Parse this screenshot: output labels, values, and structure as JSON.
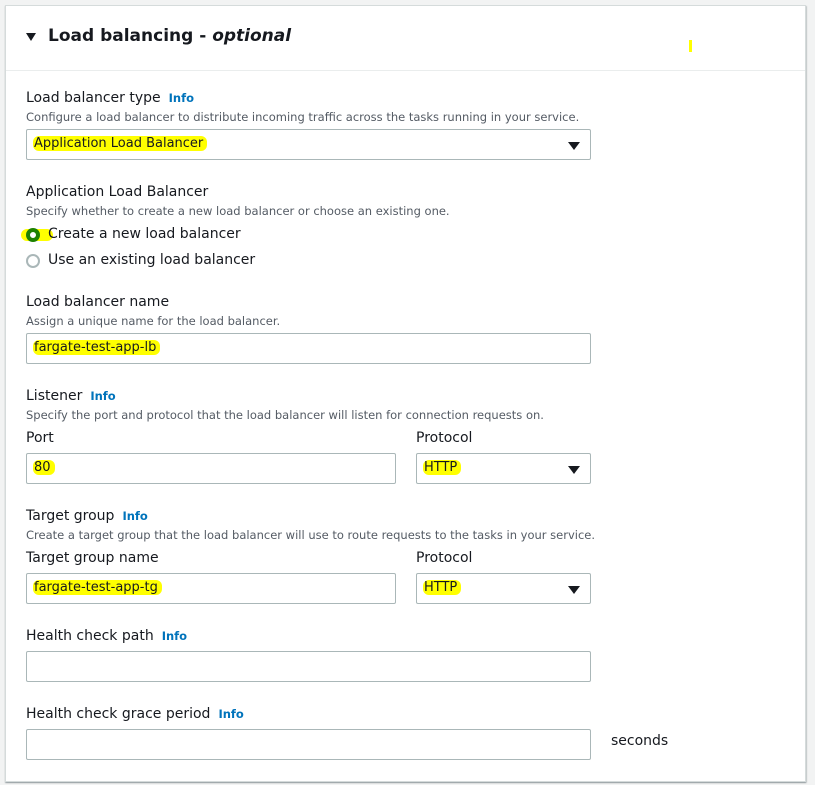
{
  "section": {
    "title": "Load balancing - ",
    "title_optional": "optional"
  },
  "lb_type": {
    "label": "Load balancer type",
    "info": "Info",
    "description": "Configure a load balancer to distribute incoming traffic across the tasks running in your service.",
    "selected": "Application Load Balancer"
  },
  "alb": {
    "label": "Application Load Balancer",
    "description": "Specify whether to create a new load balancer or choose an existing one.",
    "options": [
      {
        "label": "Create a new load balancer",
        "checked": true
      },
      {
        "label": "Use an existing load balancer",
        "checked": false
      }
    ]
  },
  "lb_name": {
    "label": "Load balancer name",
    "description": "Assign a unique name for the load balancer.",
    "value": "fargate-test-app-lb"
  },
  "listener": {
    "label": "Listener",
    "info": "Info",
    "description": "Specify the port and protocol that the load balancer will listen for connection requests on.",
    "port_label": "Port",
    "port_value": "80",
    "protocol_label": "Protocol",
    "protocol_value": "HTTP"
  },
  "target_group": {
    "label": "Target group",
    "info": "Info",
    "description": "Create a target group that the load balancer will use to route requests to the tasks in your service.",
    "name_label": "Target group name",
    "name_value": "fargate-test-app-tg",
    "protocol_label": "Protocol",
    "protocol_value": "HTTP"
  },
  "health_check_path": {
    "label": "Health check path",
    "info": "Info",
    "value": ""
  },
  "health_check_grace": {
    "label": "Health check grace period",
    "info": "Info",
    "value": "",
    "unit": "seconds"
  },
  "colors": {
    "highlight": "#ffff00",
    "info_link": "#0073bb",
    "radio_checked": "#1d8102",
    "border": "#aab7b8"
  }
}
